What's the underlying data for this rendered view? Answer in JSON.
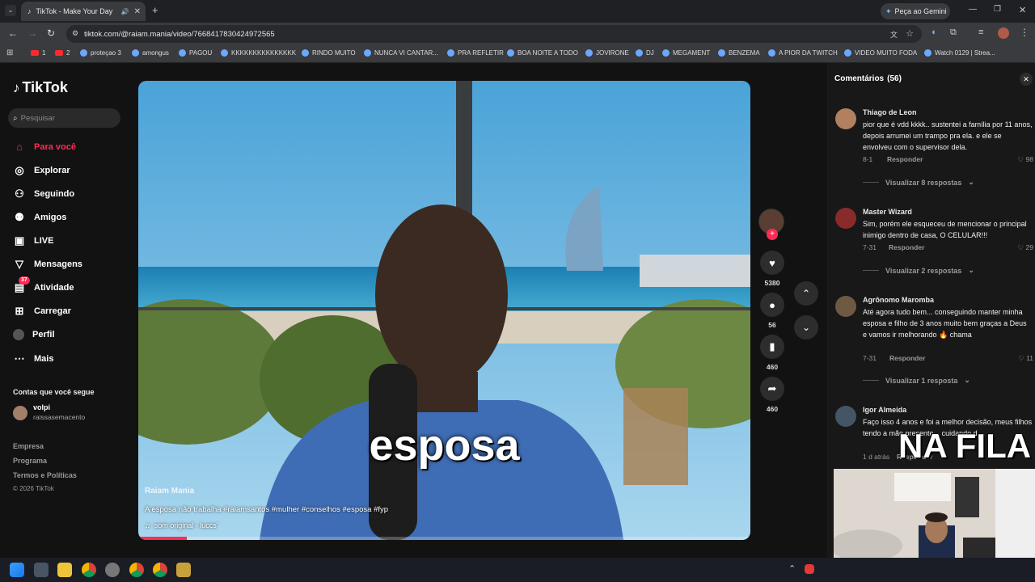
{
  "browser": {
    "tab_title": "TikTok - Make Your Day",
    "url": "tiktok.com/@raiam.mania/video/7668417830424972565",
    "gemini_label": "Peça ao Gemini",
    "bookmarks": [
      "1",
      "2",
      "proteçao 3",
      "amongus",
      "PAGOU",
      "KKKKKKKKKKKKKKK",
      "RINDO MUITO",
      "NUNCA VI CANTAR...",
      "PRA REFLETIR",
      "BOA NOITE A TODO",
      "JOVIRONE",
      "DJ",
      "MEGAMENT",
      "BENZEMA",
      "A PIOR DA TWITCH",
      "VIDEO MUITO FODA",
      "Watch 0129 | Strea..."
    ]
  },
  "sidebar": {
    "logo": "TikTok",
    "search_placeholder": "Pesquisar",
    "nav": [
      {
        "label": "Para você",
        "icon": "home-icon",
        "active": true
      },
      {
        "label": "Explorar",
        "icon": "compass-icon"
      },
      {
        "label": "Seguindo",
        "icon": "following-icon"
      },
      {
        "label": "Amigos",
        "icon": "friends-icon"
      },
      {
        "label": "LIVE",
        "icon": "live-icon"
      },
      {
        "label": "Mensagens",
        "icon": "send-icon"
      },
      {
        "label": "Atividade",
        "icon": "activity-icon",
        "badge": "37"
      },
      {
        "label": "Carregar",
        "icon": "upload-icon"
      },
      {
        "label": "Perfil",
        "icon": "profile-icon"
      },
      {
        "label": "Mais",
        "icon": "more-icon"
      }
    ],
    "following_title": "Contas que você segue",
    "following_name": "volpi",
    "following_handle": "raissasemacento",
    "footer": [
      "Empresa",
      "Programa",
      "Termos e Políticas",
      "© 2026 TikTok"
    ]
  },
  "video": {
    "caption_big": "esposa",
    "author": "Raiam Mania",
    "description": "A esposa não trabalha #raiamsantos #mulher #conselhos #esposa #fyp",
    "sound": "som original - luccs'",
    "overlay": "NA FILA"
  },
  "actions": {
    "likes": "5380",
    "comments": "56",
    "saves": "460",
    "shares": "460"
  },
  "comments": {
    "title": "Comentários",
    "count": "(56)",
    "items": [
      {
        "name": "Thiago de Leon",
        "text": "pior que é vdd kkkk.. sustentei a família por 11 anos, depois arrumei um trampo pra ela. e ele se envolveu com o supervisor dela.",
        "date": "8-1",
        "reply": "Responder",
        "likes": "98",
        "replies": "Visualizar 8 respostas"
      },
      {
        "name": "Master Wizard",
        "text": "Sim, porém ele esqueceu de mencionar o principal inimigo dentro de casa, O CELULAR!!!",
        "date": "7-31",
        "reply": "Responder",
        "likes": "29",
        "replies": "Visualizar 2 respostas"
      },
      {
        "name": "Agrônomo Maromba",
        "text": "Até agora tudo bem... conseguindo manter minha esposa e filho de 3 anos muito bem graças a Deus e vamos ir melhorando 🔥 chama",
        "date": "7-31",
        "reply": "Responder",
        "likes": "11",
        "replies": "Visualizar 1 resposta"
      },
      {
        "name": "Igor Almeida",
        "text": "Faço isso 4 anos e foi a melhor decisão, meus filhos tendo a mãe presente... cuidando d...",
        "date": "1 d atrás",
        "reply": "Responder",
        "likes": "",
        "replies": ""
      }
    ]
  }
}
